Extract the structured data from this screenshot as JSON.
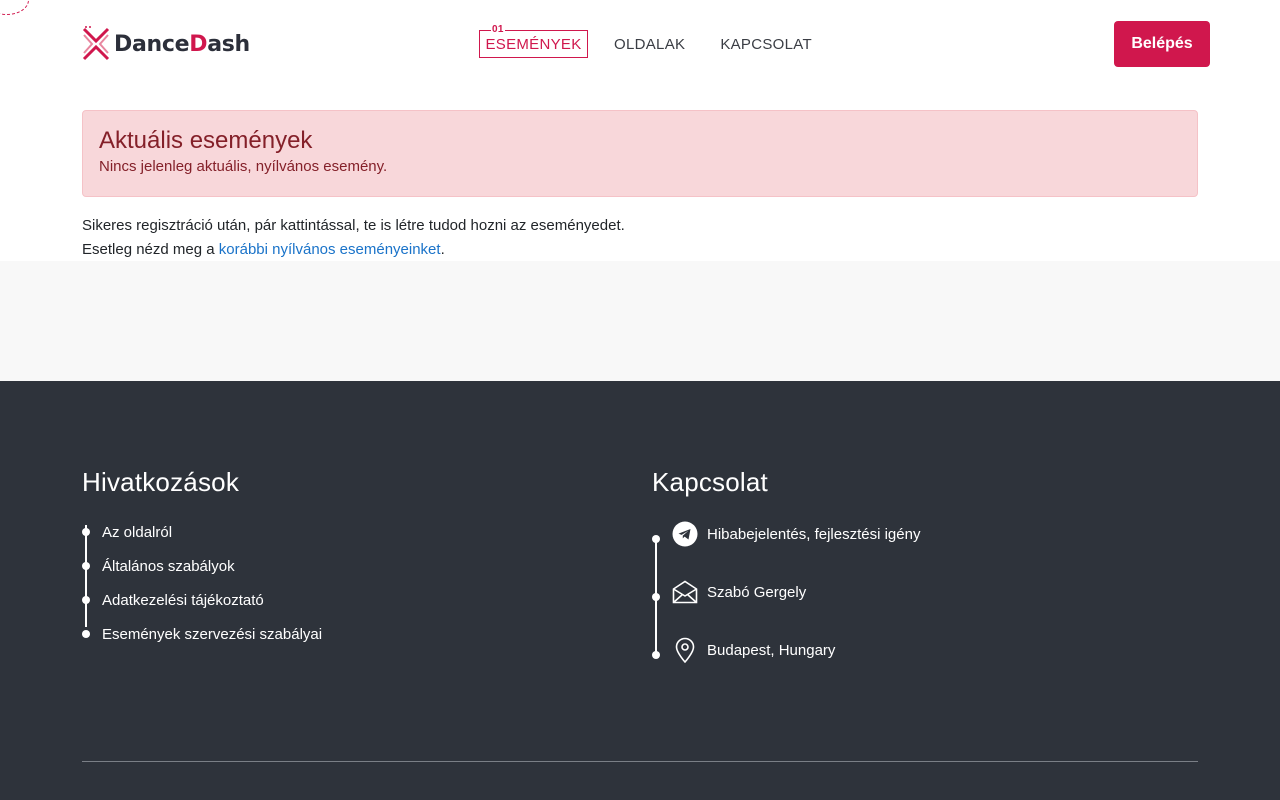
{
  "brand": {
    "name_first": "Dance",
    "name_d": "D",
    "name_rest": "ash",
    "accent_color": "#d0174d"
  },
  "nav": {
    "active_number": "01",
    "items": [
      {
        "label": "ESEMÉNYEK",
        "active": true
      },
      {
        "label": "OLDALAK",
        "active": false
      },
      {
        "label": "KAPCSOLAT",
        "active": false
      }
    ]
  },
  "header": {
    "login_label": "Belépés"
  },
  "alert": {
    "title": "Aktuális események",
    "text": "Nincs jelenleg aktuális, nyílvános esemény."
  },
  "info": {
    "line1": "Sikeres regisztráció után, pár kattintással, te is létre tudod hozni az eseményedet.",
    "line2_prefix": "Esetleg nézd meg a ",
    "line2_link": "korábbi nyílvános eseményeinket",
    "line2_suffix": "."
  },
  "footer": {
    "links_title": "Hivatkozások",
    "links": [
      {
        "label": "Az oldalról"
      },
      {
        "label": "Általános szabályok"
      },
      {
        "label": "Adatkezelési tájékoztató"
      },
      {
        "label": "Események szervezési szabályai"
      }
    ],
    "contact_title": "Kapcsolat",
    "contacts": [
      {
        "icon": "telegram-icon",
        "label": "Hibabejelentés, fejlesztési igény"
      },
      {
        "icon": "envelope-icon",
        "label": "Szabó Gergely"
      },
      {
        "icon": "map-pin-icon",
        "label": "Budapest, Hungary"
      }
    ],
    "bg_color": "#2e333b"
  }
}
